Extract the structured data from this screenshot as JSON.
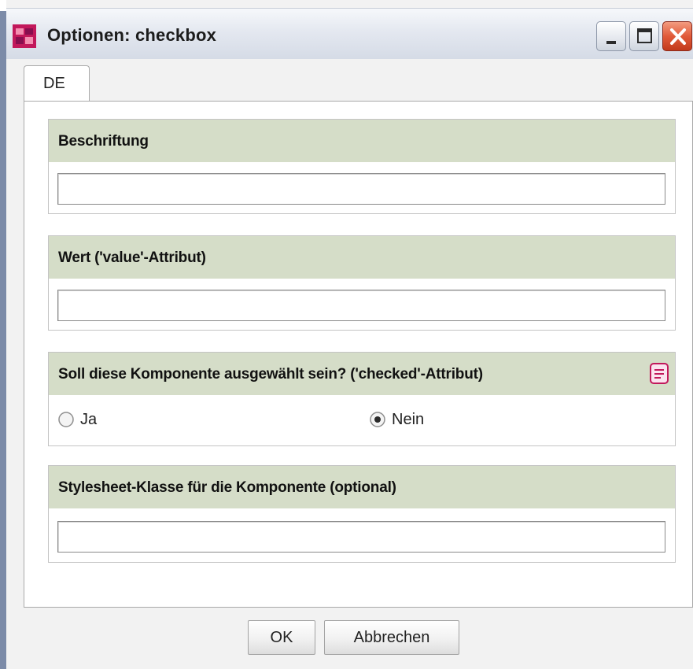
{
  "window": {
    "title": "Optionen: checkbox",
    "app_icon": "firstspirit-app-icon",
    "controls": [
      "minimize-icon",
      "maximize-icon",
      "close-icon"
    ]
  },
  "tabs": [
    {
      "label": "DE",
      "selected": true
    }
  ],
  "fields": {
    "label": {
      "header": "Beschriftung",
      "value": ""
    },
    "value": {
      "header": "Wert ('value'-Attribut)",
      "value": ""
    },
    "checked": {
      "header": "Soll diese Komponente ausgewählt sein? ('checked'-Attribut)",
      "note_icon": "note-icon",
      "options": [
        {
          "label": "Ja",
          "selected": false
        },
        {
          "label": "Nein",
          "selected": true
        }
      ]
    },
    "css_class": {
      "header": "Stylesheet-Klasse für die Komponente (optional)",
      "value": ""
    }
  },
  "buttons": {
    "ok": "OK",
    "cancel": "Abbrechen"
  },
  "colors": {
    "group_header_bg": "#d5ddc8",
    "title_bar": "#e4e8f0",
    "close_button": "#e15b3a"
  }
}
